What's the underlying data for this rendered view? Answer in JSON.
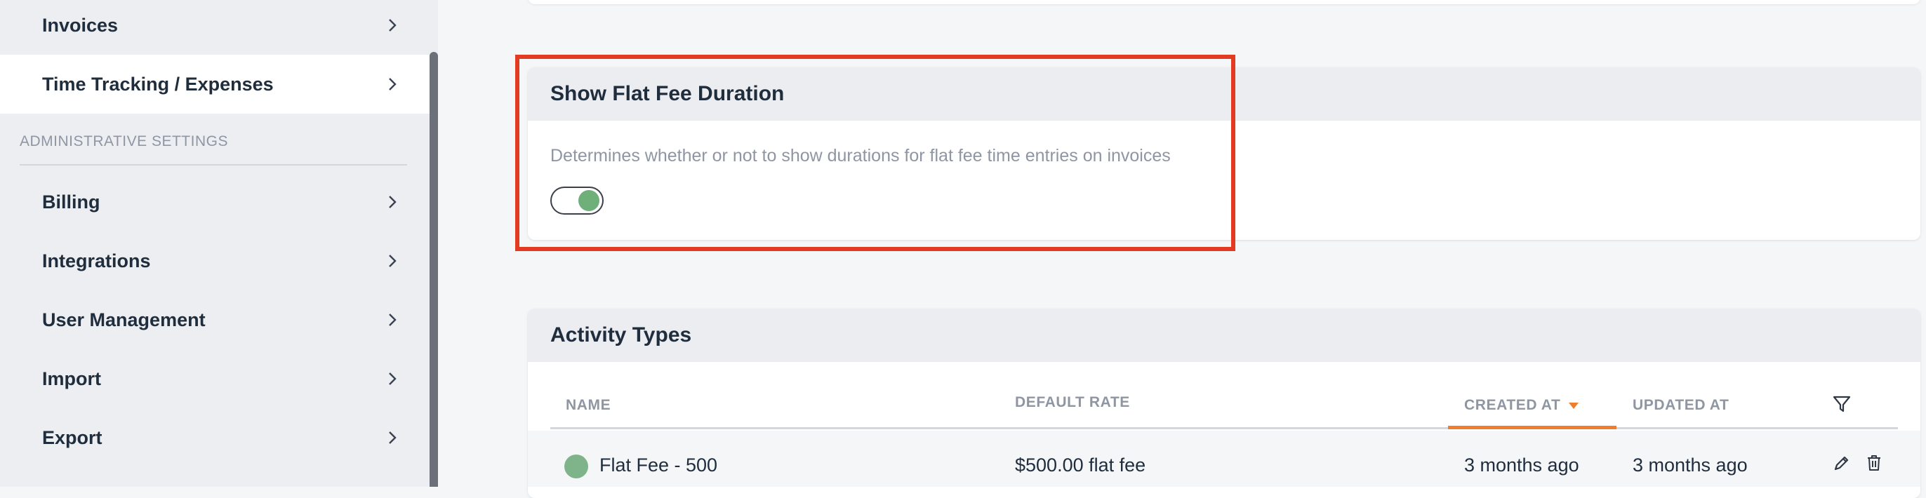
{
  "sidebar": {
    "items_top": [
      {
        "label": "Invoices"
      },
      {
        "label": "Time Tracking / Expenses"
      }
    ],
    "section_header": "ADMINISTRATIVE SETTINGS",
    "items_admin": [
      {
        "label": "Billing"
      },
      {
        "label": "Integrations"
      },
      {
        "label": "User Management"
      },
      {
        "label": "Import"
      },
      {
        "label": "Export"
      }
    ],
    "active_item": "Time Tracking / Expenses"
  },
  "flat_fee_card": {
    "title": "Show Flat Fee Duration",
    "description": "Determines whether or not to show durations for flat fee time entries on invoices",
    "toggle_on": true
  },
  "activity_types": {
    "title": "Activity Types",
    "columns": {
      "name": "NAME",
      "default_rate": "DEFAULT RATE",
      "created_at": "CREATED AT",
      "updated_at": "UPDATED AT"
    },
    "sorted_by": "CREATED AT",
    "rows": [
      {
        "name": "Flat Fee - 500",
        "default_rate": "$500.00 flat fee",
        "created_at": "3 months ago",
        "updated_at": "3 months ago",
        "color": "#7fb38a"
      }
    ]
  },
  "colors": {
    "highlight": "#e23b22",
    "toggle_on": "#6fb07a",
    "sort_accent": "#ef7d2b"
  }
}
